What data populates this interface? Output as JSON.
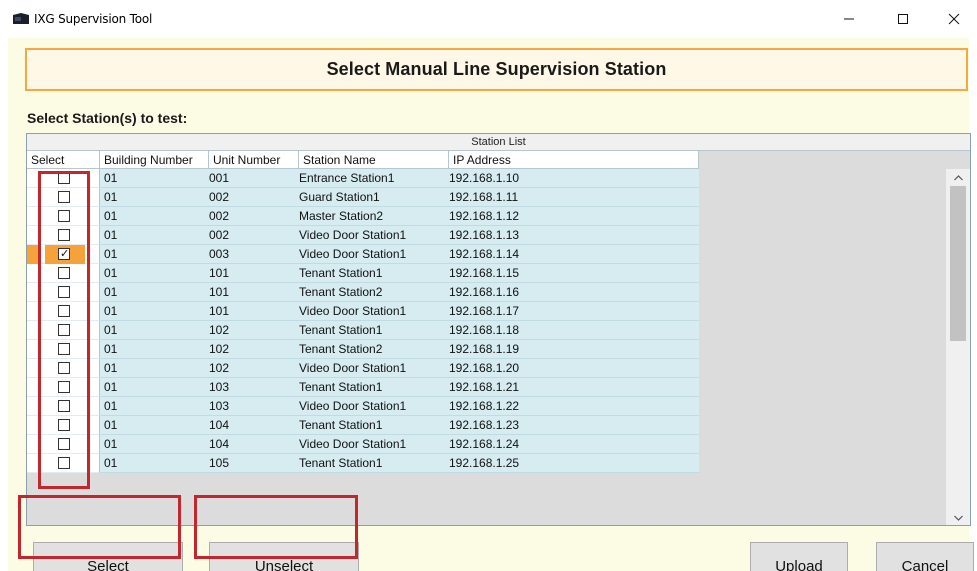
{
  "window": {
    "title": "IXG Supervision Tool",
    "controls": {
      "minimize": "—",
      "maximize": "☐",
      "close": "✕"
    }
  },
  "header": {
    "title": "Select Manual Line Supervision Station"
  },
  "prompt": "Select Station(s) to test:",
  "grid": {
    "title": "Station List",
    "columns": [
      "Select",
      "Building Number",
      "Unit Number",
      "Station Name",
      "IP Address"
    ],
    "rows": [
      {
        "checked": false,
        "building": "01",
        "unit": "001",
        "name": "Entrance Station1",
        "ip": "192.168.1.10"
      },
      {
        "checked": false,
        "building": "01",
        "unit": "002",
        "name": "Guard Station1",
        "ip": "192.168.1.11"
      },
      {
        "checked": false,
        "building": "01",
        "unit": "002",
        "name": "Master Station2",
        "ip": "192.168.1.12"
      },
      {
        "checked": false,
        "building": "01",
        "unit": "002",
        "name": "Video Door Station1",
        "ip": "192.168.1.13"
      },
      {
        "checked": true,
        "building": "01",
        "unit": "003",
        "name": "Video Door Station1",
        "ip": "192.168.1.14"
      },
      {
        "checked": false,
        "building": "01",
        "unit": "101",
        "name": "Tenant Station1",
        "ip": "192.168.1.15"
      },
      {
        "checked": false,
        "building": "01",
        "unit": "101",
        "name": "Tenant Station2",
        "ip": "192.168.1.16"
      },
      {
        "checked": false,
        "building": "01",
        "unit": "101",
        "name": "Video Door Station1",
        "ip": "192.168.1.17"
      },
      {
        "checked": false,
        "building": "01",
        "unit": "102",
        "name": "Tenant Station1",
        "ip": "192.168.1.18"
      },
      {
        "checked": false,
        "building": "01",
        "unit": "102",
        "name": "Tenant Station2",
        "ip": "192.168.1.19"
      },
      {
        "checked": false,
        "building": "01",
        "unit": "102",
        "name": "Video Door Station1",
        "ip": "192.168.1.20"
      },
      {
        "checked": false,
        "building": "01",
        "unit": "103",
        "name": "Tenant Station1",
        "ip": "192.168.1.21"
      },
      {
        "checked": false,
        "building": "01",
        "unit": "103",
        "name": "Video Door Station1",
        "ip": "192.168.1.22"
      },
      {
        "checked": false,
        "building": "01",
        "unit": "104",
        "name": "Tenant Station1",
        "ip": "192.168.1.23"
      },
      {
        "checked": false,
        "building": "01",
        "unit": "104",
        "name": "Video Door Station1",
        "ip": "192.168.1.24"
      },
      {
        "checked": false,
        "building": "01",
        "unit": "105",
        "name": "Tenant Station1",
        "ip": "192.168.1.25"
      }
    ]
  },
  "buttons": {
    "select": "Select",
    "unselect": "Unselect",
    "upload": "Upload",
    "cancel": "Cancel"
  },
  "colors": {
    "accent_orange": "#f5a741",
    "highlight_red": "#c1272d",
    "row_blue": "#d6ecf1",
    "client_bg": "#fcfbe3"
  }
}
